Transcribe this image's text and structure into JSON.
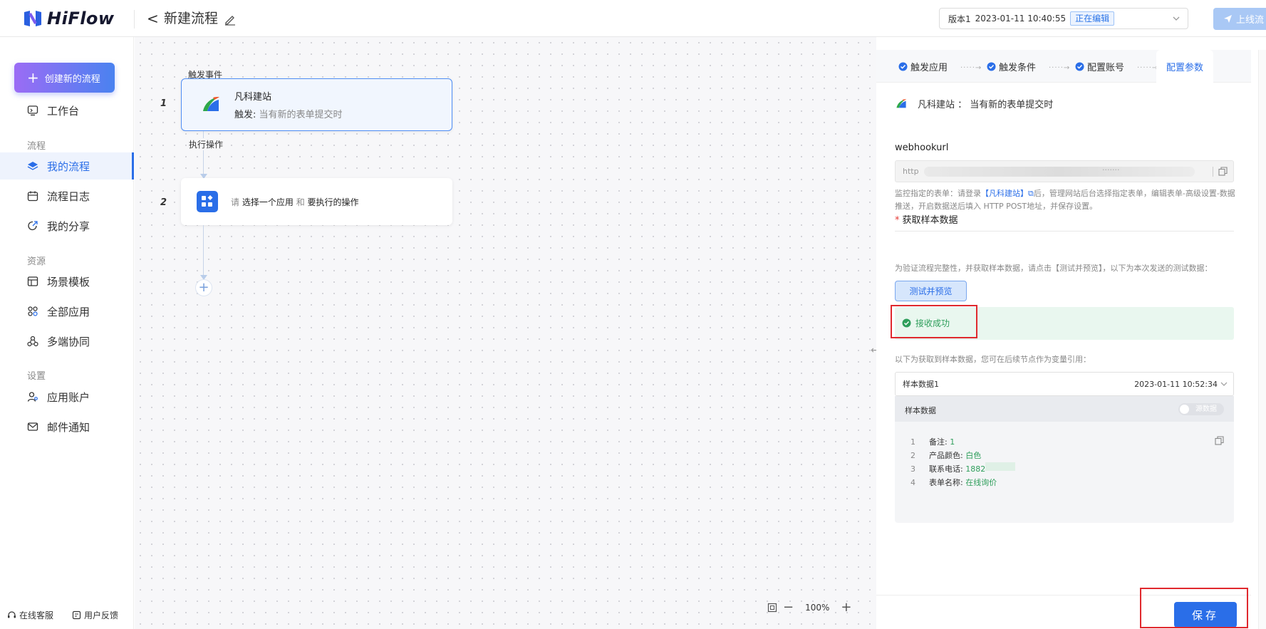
{
  "header": {
    "logo_text": "HiFlow",
    "back": "<",
    "title": "新建流程",
    "version": "版本1",
    "version_date": "2023-01-11 10:40:55",
    "version_status": "正在编辑",
    "publish_label": "上线流"
  },
  "sidebar": {
    "create_label": "创建新的流程",
    "items": [
      {
        "label": "工作台",
        "icon": "monitor-icon"
      },
      {
        "section": "流程"
      },
      {
        "label": "我的流程",
        "icon": "layers-icon",
        "active": true
      },
      {
        "label": "流程日志",
        "icon": "calendar-icon"
      },
      {
        "label": "我的分享",
        "icon": "share-icon"
      },
      {
        "section": "资源"
      },
      {
        "label": "场景模板",
        "icon": "template-icon"
      },
      {
        "label": "全部应用",
        "icon": "apps-icon"
      },
      {
        "label": "多端协同",
        "icon": "sync-icon"
      },
      {
        "section": "设置"
      },
      {
        "label": "应用账户",
        "icon": "user-icon"
      },
      {
        "label": "邮件通知",
        "icon": "mail-icon"
      }
    ],
    "footer": {
      "service": "在线客服",
      "feedback": "用户反馈"
    }
  },
  "canvas": {
    "trigger_label": "触发事件",
    "action_label": "执行操作",
    "node1": {
      "num": "1",
      "title": "凡科建站",
      "sub_prefix": "触发:",
      "sub_text": "当有新的表单提交时"
    },
    "node2": {
      "num": "2",
      "text_a": "请",
      "text_b": "选择一个应用",
      "text_c": "和",
      "text_d": "要执行的操作"
    },
    "add": "+",
    "zoom": {
      "minus": "−",
      "value": "100%",
      "plus": "+"
    }
  },
  "panel": {
    "steps": [
      "触发应用",
      "触发条件",
      "配置账号",
      "配置参数"
    ],
    "app_line": "凡科建站 ： 当有新的表单提交时",
    "webhook_label": "webhookurl",
    "webhook_value": "http",
    "webhook_dots": "·······",
    "help_a": "监控指定的表单：请登录",
    "help_link": "【凡科建站】",
    "help_b": "后，管理网站后台选择指定表单，编辑表单-高级设置-数据推送，开启数据送后填入 HTTP POST地址，并保存设置。",
    "sample_title": "获取样本数据",
    "sample_desc": "为验证流程完整性，并获取样本数据，请点击【测试并预览】，以下为本次发送的测试数据：",
    "test_btn": "测试并预览",
    "success": "接收成功",
    "sample_hint": "以下为获取到样本数据，您可在后续节点作为变量引用：",
    "select_label": "样本数据1",
    "select_date": "2023-01-11 10:52:34",
    "card_title": "样本数据",
    "toggle_label": "源数据",
    "rows": [
      {
        "n": "1",
        "k": "备注:",
        "v": "1"
      },
      {
        "n": "2",
        "k": "产品颜色:",
        "v": "白色"
      },
      {
        "n": "3",
        "k": "联系电话:",
        "v": "1882"
      },
      {
        "n": "4",
        "k": "表单名称:",
        "v": "在线询价"
      }
    ],
    "save": "保存"
  },
  "colors": {
    "primary": "#2a6ee8",
    "success": "#2e9e5b",
    "highlight": "#e0292e"
  }
}
